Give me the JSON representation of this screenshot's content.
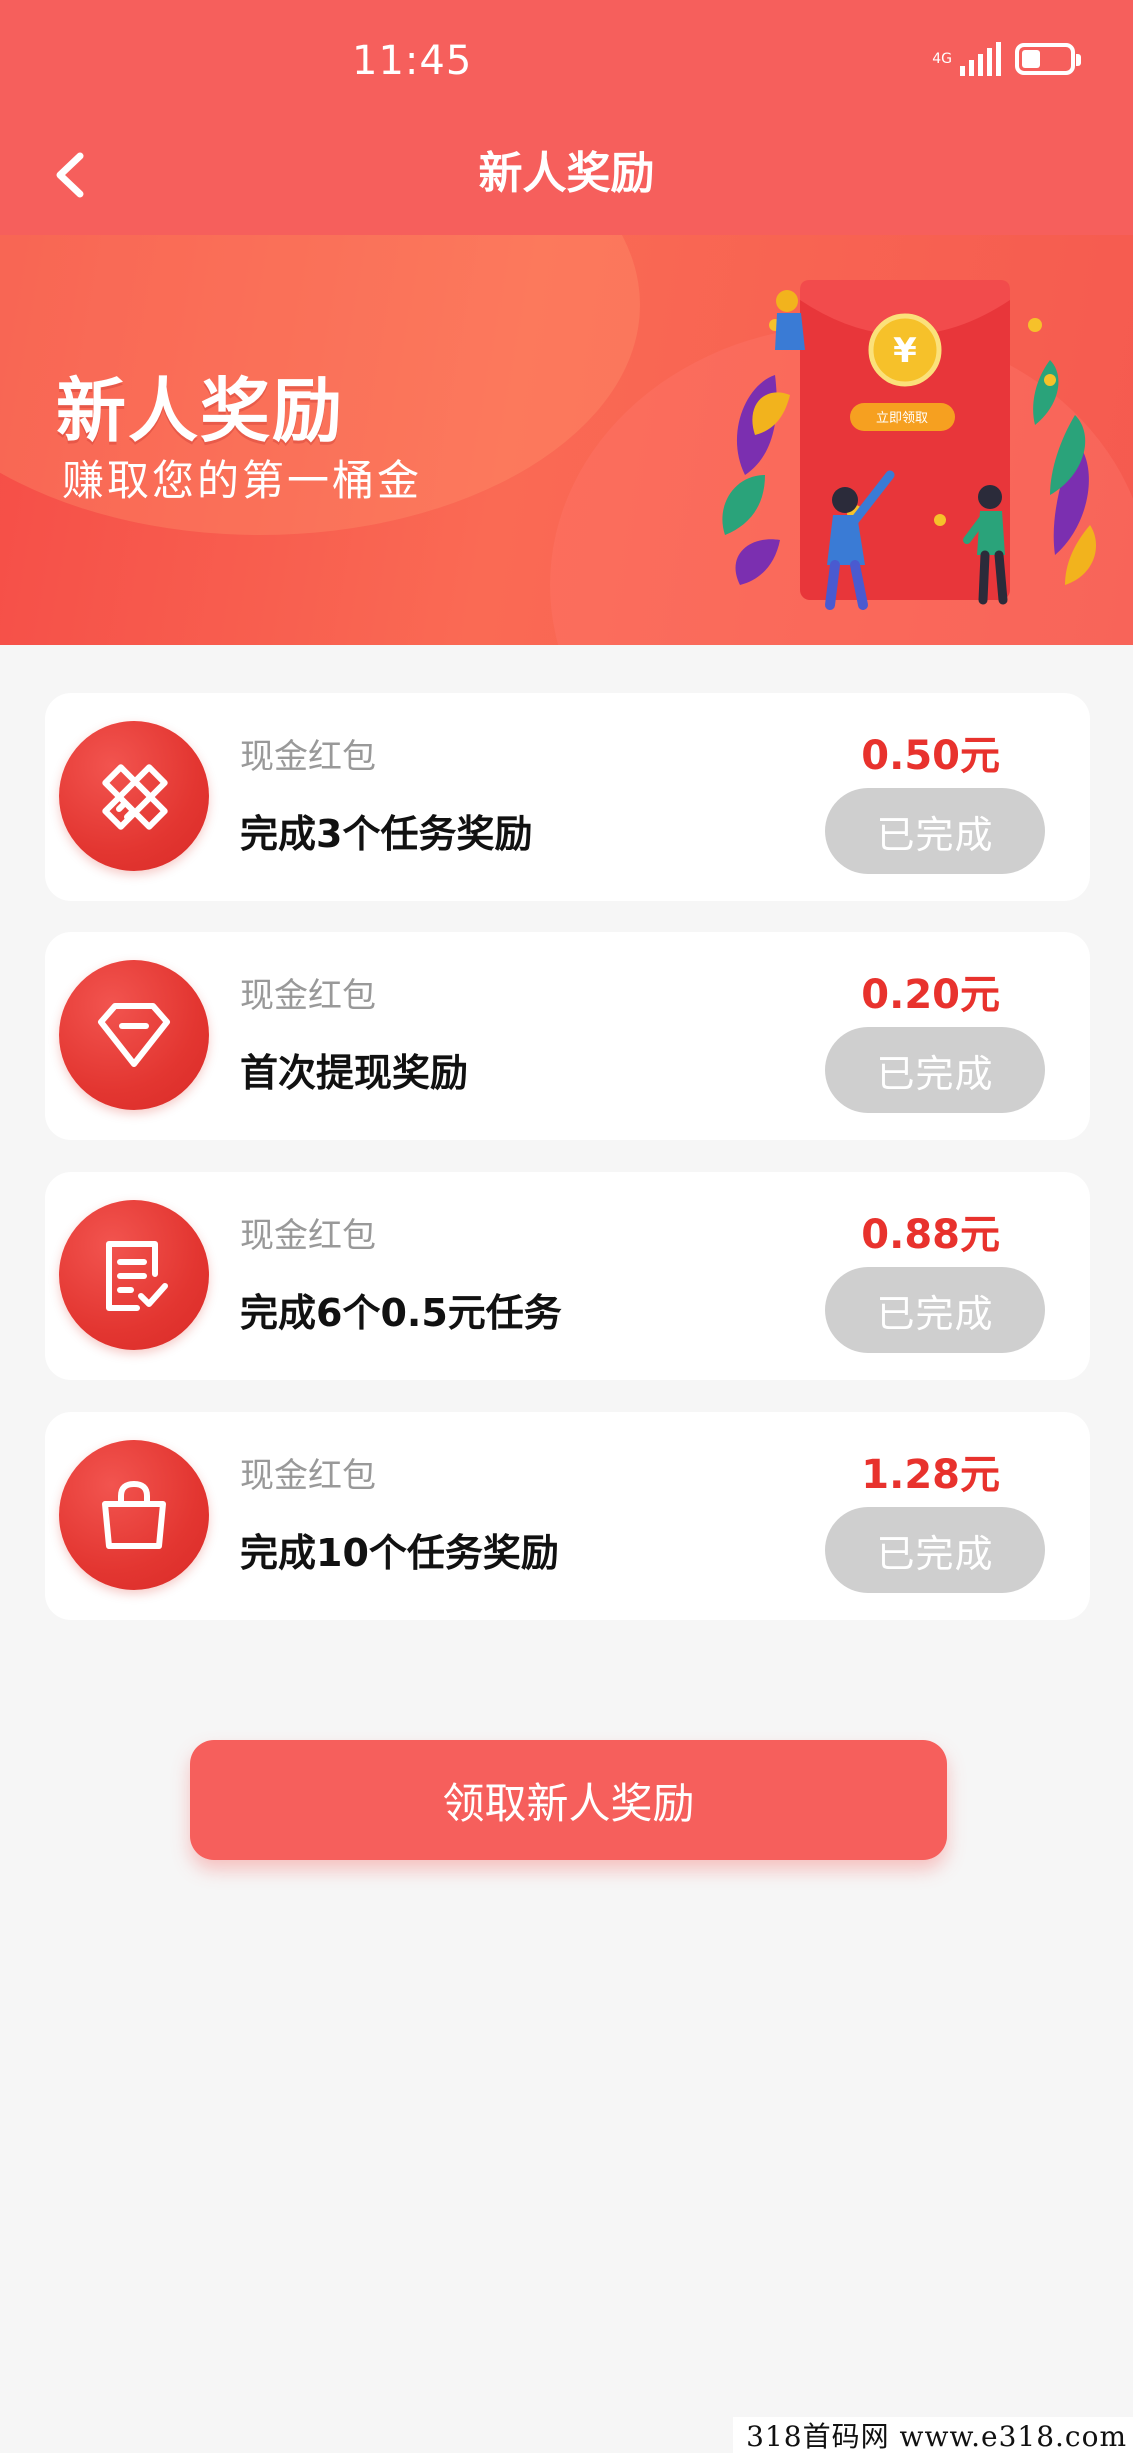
{
  "status_bar": {
    "time": "11:45",
    "network": "4G",
    "battery_level": 0.4
  },
  "header": {
    "title": "新人奖励"
  },
  "banner": {
    "title": "新人奖励",
    "subtitle": "赚取您的第一桶金",
    "art_button_label": "立即领取"
  },
  "rewards": [
    {
      "type": "现金红包",
      "title": "完成3个任务奖励",
      "amount": "0.50元",
      "status": "已完成",
      "icon": "pencil-ruler-icon"
    },
    {
      "type": "现金红包",
      "title": "首次提现奖励",
      "amount": "0.20元",
      "status": "已完成",
      "icon": "diamond-icon"
    },
    {
      "type": "现金红包",
      "title": "完成6个0.5元任务",
      "amount": "0.88元",
      "status": "已完成",
      "icon": "checklist-icon"
    },
    {
      "type": "现金红包",
      "title": "完成10个任务奖励",
      "amount": "1.28元",
      "status": "已完成",
      "icon": "shopping-bag-icon"
    }
  ],
  "claim_button": {
    "label": "领取新人奖励"
  },
  "watermark": {
    "text": "318首码网  www.e318.com"
  },
  "colors": {
    "primary": "#f65f5c",
    "amount": "#e8322d",
    "completed_button": "#cfcfcf"
  }
}
